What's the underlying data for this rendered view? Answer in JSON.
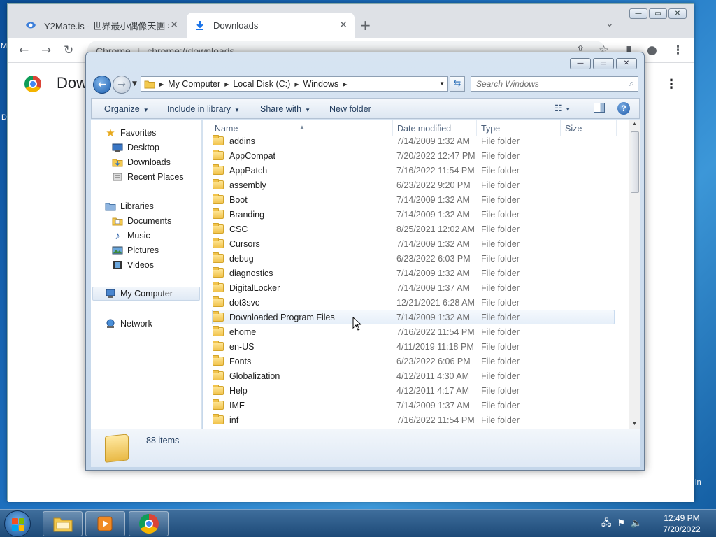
{
  "desktop": {
    "left_edge_texts": [
      "M",
      "D"
    ],
    "right_edge_text": "in"
  },
  "chrome": {
    "tabs": [
      {
        "title": "Y2Mate.is - 世界最小偶像天團 #"
      },
      {
        "title": "Downloads"
      }
    ],
    "new_tab": "+",
    "address_scheme": "Chrome",
    "address_url": "chrome://downloads",
    "page_title": "Dow"
  },
  "explorer": {
    "breadcrumb": [
      "My Computer",
      "Local Disk (C:)",
      "Windows"
    ],
    "search_placeholder": "Search Windows",
    "commands": {
      "organize": "Organize",
      "include_in_library": "Include in library",
      "share_with": "Share with",
      "new_folder": "New folder"
    },
    "nav": {
      "favorites": {
        "label": "Favorites",
        "items": [
          "Desktop",
          "Downloads",
          "Recent Places"
        ]
      },
      "libraries": {
        "label": "Libraries",
        "items": [
          "Documents",
          "Music",
          "Pictures",
          "Videos"
        ]
      },
      "my_computer": "My Computer",
      "network": "Network"
    },
    "columns": {
      "name": "Name",
      "date": "Date modified",
      "type": "Type",
      "size": "Size"
    },
    "files": [
      {
        "name": "addins",
        "date": "7/14/2009 1:32 AM",
        "type": "File folder"
      },
      {
        "name": "AppCompat",
        "date": "7/20/2022 12:47 PM",
        "type": "File folder"
      },
      {
        "name": "AppPatch",
        "date": "7/16/2022 11:54 PM",
        "type": "File folder"
      },
      {
        "name": "assembly",
        "date": "6/23/2022 9:20 PM",
        "type": "File folder"
      },
      {
        "name": "Boot",
        "date": "7/14/2009 1:32 AM",
        "type": "File folder"
      },
      {
        "name": "Branding",
        "date": "7/14/2009 1:32 AM",
        "type": "File folder"
      },
      {
        "name": "CSC",
        "date": "8/25/2021 12:02 AM",
        "type": "File folder"
      },
      {
        "name": "Cursors",
        "date": "7/14/2009 1:32 AM",
        "type": "File folder"
      },
      {
        "name": "debug",
        "date": "6/23/2022 6:03 PM",
        "type": "File folder"
      },
      {
        "name": "diagnostics",
        "date": "7/14/2009 1:32 AM",
        "type": "File folder"
      },
      {
        "name": "DigitalLocker",
        "date": "7/14/2009 1:37 AM",
        "type": "File folder"
      },
      {
        "name": "dot3svc",
        "date": "12/21/2021 6:28 AM",
        "type": "File folder"
      },
      {
        "name": "Downloaded Program Files",
        "date": "7/14/2009 1:32 AM",
        "type": "File folder"
      },
      {
        "name": "ehome",
        "date": "7/16/2022 11:54 PM",
        "type": "File folder"
      },
      {
        "name": "en-US",
        "date": "4/11/2019 11:18 PM",
        "type": "File folder"
      },
      {
        "name": "Fonts",
        "date": "6/23/2022 6:06 PM",
        "type": "File folder"
      },
      {
        "name": "Globalization",
        "date": "4/12/2011 4:30 AM",
        "type": "File folder"
      },
      {
        "name": "Help",
        "date": "4/12/2011 4:17 AM",
        "type": "File folder"
      },
      {
        "name": "IME",
        "date": "7/14/2009 1:37 AM",
        "type": "File folder"
      },
      {
        "name": "inf",
        "date": "7/16/2022 11:54 PM",
        "type": "File folder"
      }
    ],
    "hovered_file": "Downloaded Program Files",
    "status": "88 items"
  },
  "taskbar": {
    "time": "12:49 PM",
    "date": "7/20/2022"
  }
}
